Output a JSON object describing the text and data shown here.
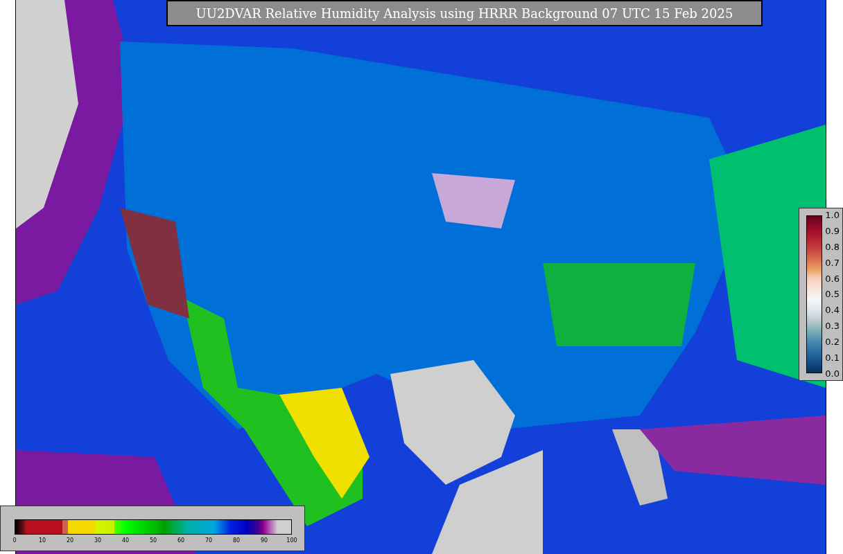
{
  "title": "UU2DVAR Relative Humidity Analysis using HRRR Background 07 UTC 15 Feb 2025",
  "humidity_colorbar": {
    "ticks": [
      "0",
      "10",
      "20",
      "30",
      "40",
      "50",
      "60",
      "70",
      "80",
      "90",
      "100"
    ]
  },
  "observation_colorbar": {
    "ticks": [
      "1.0",
      "0.9",
      "0.8",
      "0.7",
      "0.6",
      "0.5",
      "0.4",
      "0.3",
      "0.2",
      "0.1",
      "0.0"
    ]
  }
}
